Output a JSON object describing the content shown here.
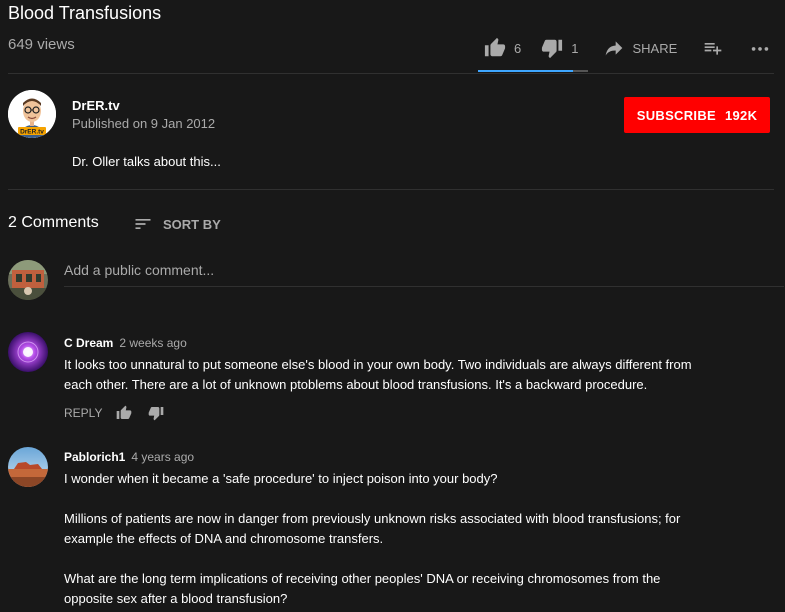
{
  "video": {
    "title": "Blood Transfusions",
    "views": "649 views",
    "likes": "6",
    "dislikes": "1",
    "share_label": "SHARE",
    "like_fraction": 0.86
  },
  "channel": {
    "name": "DrER.tv",
    "published": "Published on 9 Jan 2012",
    "subscribe_label": "SUBSCRIBE",
    "subscriber_count": "192K",
    "avatar_text": "DrER.tv"
  },
  "description": "Dr. Oller talks about this...",
  "comments": {
    "count_label": "2 Comments",
    "sort_label": "SORT BY",
    "add_placeholder": "Add a public comment...",
    "reply_label": "REPLY",
    "items": [
      {
        "author": "C Dream",
        "time": "2 weeks ago",
        "lines": [
          "It looks too unnatural to put someone else's blood in your own body. Two individuals are always different from",
          "each other. There are a lot of unknown ptoblems about blood transfusions. It's a backward procedure."
        ]
      },
      {
        "author": "Pablorich1",
        "time": "4 years ago",
        "lines": [
          "I wonder when it became a 'safe procedure' to inject poison into your body?",
          "Millions of patients are now in danger from previously unknown risks associated with blood transfusions; for",
          "example the effects of DNA and chromosome transfers.",
          "What are the long term implications of receiving other peoples' DNA or receiving chromosomes from the",
          "opposite sex after a blood transfusion?"
        ]
      }
    ]
  },
  "colors": {
    "background": "#181818",
    "subscribe": "#ff0000",
    "like_bar": "#3ea6ff",
    "secondary_text": "#aaaaaa"
  }
}
